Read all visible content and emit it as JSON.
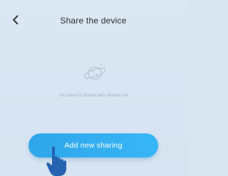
{
  "header": {
    "title": "Share the device",
    "back_icon": "chevron-left-icon"
  },
  "empty_state": {
    "icon": "planet-icon",
    "message": "You haven't shared with anyone yet"
  },
  "actions": {
    "add_label": "Add new sharing",
    "pointer_icon": "hand-pointer-icon"
  },
  "colors": {
    "background": "#d9e6f2",
    "button": "#33aff0",
    "button_text": "#ffffff",
    "muted_text": "#9eb1c3"
  }
}
